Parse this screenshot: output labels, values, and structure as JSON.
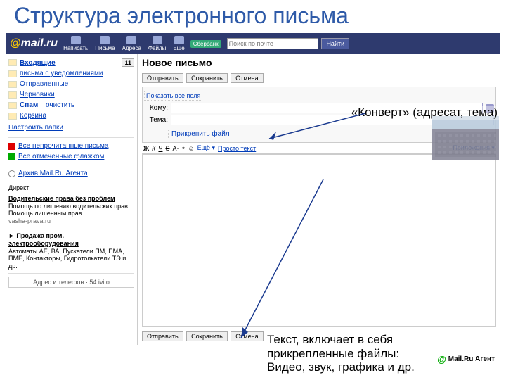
{
  "slide_title": "Структура электронного письма",
  "topbar": {
    "logo_at": "@",
    "logo_text": "mail.ru",
    "nav": [
      "Написать",
      "Письма",
      "Адреса",
      "Файлы",
      "Ещё"
    ],
    "sber": "Сбербанк",
    "search_placeholder": "Поиск по почте",
    "search_btn": "Найти"
  },
  "sidebar": {
    "folders": [
      {
        "name": "Входящие",
        "count": "11"
      },
      {
        "name": "письма с уведомлениями"
      },
      {
        "name": "Отправленные"
      },
      {
        "name": "Черновики"
      },
      {
        "name": "Спам",
        "extra": "очистить"
      },
      {
        "name": "Корзина"
      }
    ],
    "configure": "Настроить папки",
    "flags": [
      {
        "label": "Все непрочитанные письма"
      },
      {
        "label": "Все отмеченные флажком"
      }
    ],
    "archive": "Архив Mail.Ru Агента",
    "direkt": "Директ",
    "ads": [
      {
        "title": "Водительские права без проблем",
        "body": "Помощь по лишению водительских прав. Помощь лишенным прав",
        "url": "vasha-prava.ru"
      },
      {
        "title": "Продажа пром. электрооборудования",
        "body": "Автоматы АЕ, ВА, Пускатели ПМ, ПМА, ПМЕ, Контакторы, Гидротолкатели ТЭ и др.",
        "url": ""
      }
    ],
    "bottom_link": "Адрес и телефон · 54.ivito"
  },
  "content": {
    "page_head": "Новое письмо",
    "btn_send": "Отправить",
    "btn_save": "Сохранить",
    "btn_cancel": "Отмена",
    "show_all": "Показать все поля",
    "lbl_to": "Кому:",
    "lbl_subj": "Тема:",
    "attach": "Прикрепить файл",
    "tb": [
      "Ж",
      "К",
      "Ч",
      "Ѕ",
      "A·",
      "٭",
      "☺",
      "Ещё ▾",
      "Просто текст",
      "Приложения ▾"
    ]
  },
  "annot": {
    "a1": "«Конверт» (адресат, тема)",
    "a2": "Текст, включает в себя\nприкрепленные файлы:\nВидео, звук, графика и др."
  },
  "agent": "Mail.Ru Агент"
}
